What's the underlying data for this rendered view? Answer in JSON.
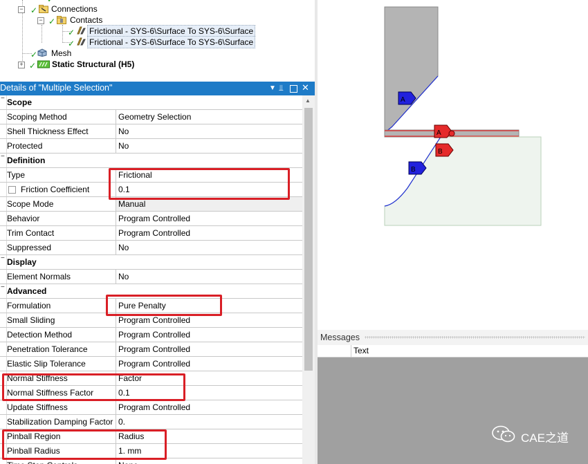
{
  "tree": {
    "nodes": [
      {
        "label": "Connections",
        "level": 1
      },
      {
        "label": "Contacts",
        "level": 2
      },
      {
        "label": "Frictional - SYS-6\\Surface To SYS-6\\Surface",
        "level": 3
      },
      {
        "label": "Frictional - SYS-6\\Surface To SYS-6\\Surface",
        "level": 3
      },
      {
        "label": "Mesh",
        "level": 1
      },
      {
        "label": "Static Structural (H5)",
        "level": 0
      }
    ]
  },
  "details": {
    "title": "Details of \"Multiple Selection\"",
    "pin_glyph": "▼ ⊥ □ ✕",
    "rows": [
      {
        "type": "section",
        "label": "Scope"
      },
      {
        "type": "row",
        "label": "Scoping Method",
        "value": "Geometry Selection"
      },
      {
        "type": "row",
        "label": "Shell Thickness Effect",
        "value": "No"
      },
      {
        "type": "row",
        "label": "Protected",
        "value": "No"
      },
      {
        "type": "section",
        "label": "Definition"
      },
      {
        "type": "row",
        "label": "Type",
        "value": "Frictional"
      },
      {
        "type": "row",
        "label": "Friction Coefficient",
        "value": "0.1",
        "checkbox": true
      },
      {
        "type": "row",
        "label": "Scope Mode",
        "value": "Manual",
        "gray": true
      },
      {
        "type": "row",
        "label": "Behavior",
        "value": "Program Controlled"
      },
      {
        "type": "row",
        "label": "Trim Contact",
        "value": "Program Controlled"
      },
      {
        "type": "row",
        "label": "Suppressed",
        "value": "No"
      },
      {
        "type": "section",
        "label": "Display"
      },
      {
        "type": "row",
        "label": "Element Normals",
        "value": "No"
      },
      {
        "type": "section",
        "label": "Advanced"
      },
      {
        "type": "row",
        "label": "Formulation",
        "value": "Pure Penalty"
      },
      {
        "type": "row",
        "label": "Small Sliding",
        "value": "Program Controlled"
      },
      {
        "type": "row",
        "label": "Detection Method",
        "value": "Program Controlled"
      },
      {
        "type": "row",
        "label": "Penetration Tolerance",
        "value": "Program Controlled"
      },
      {
        "type": "row",
        "label": "Elastic Slip Tolerance",
        "value": "Program Controlled"
      },
      {
        "type": "row",
        "label": "Normal Stiffness",
        "value": "Factor"
      },
      {
        "type": "row",
        "label": "Normal Stiffness Factor",
        "value": "0.1"
      },
      {
        "type": "row",
        "label": "Update Stiffness",
        "value": "Program Controlled"
      },
      {
        "type": "row",
        "label": "Stabilization Damping Factor",
        "value": "0."
      },
      {
        "type": "row",
        "label": "Pinball Region",
        "value": "Radius"
      },
      {
        "type": "row",
        "label": "Pinball Radius",
        "value": "1. mm"
      },
      {
        "type": "row",
        "label": "Time Step Controls",
        "value": "None"
      }
    ]
  },
  "graphics": {
    "markers": [
      {
        "label": "A",
        "color": "#2222dd"
      },
      {
        "label": "A",
        "color": "#e52b2b"
      },
      {
        "label": "B",
        "color": "#e52b2b"
      },
      {
        "label": "B",
        "color": "#2222dd"
      }
    ],
    "colors": {
      "body_gray": "#b4b4b4",
      "body_green": "#eef4ee",
      "edge_blue": "#1f2fd0",
      "contact_red": "#e52b2b"
    }
  },
  "messages": {
    "title": "Messages",
    "column_text": "Text"
  },
  "watermark": {
    "text": "CAE之道"
  }
}
